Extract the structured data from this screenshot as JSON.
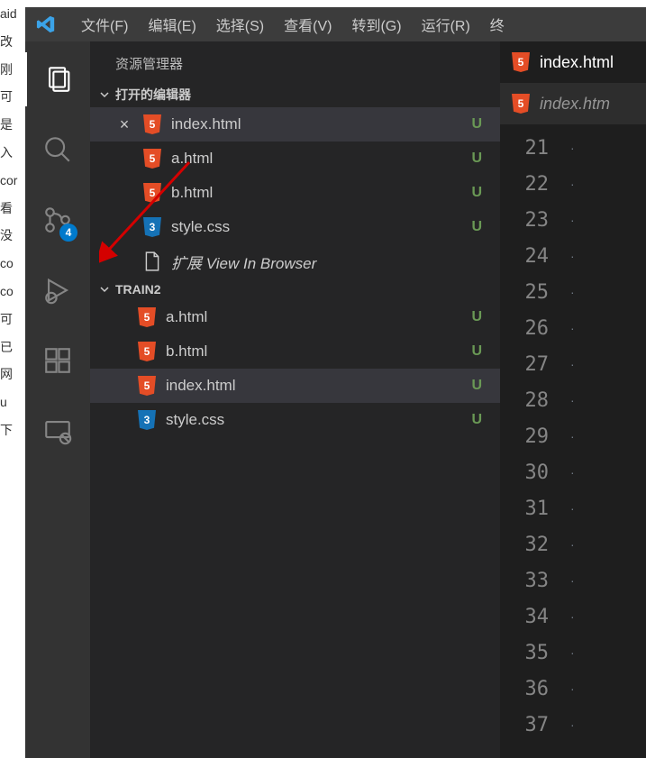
{
  "bg_fragments": [
    "aid",
    "改",
    "刚",
    "可",
    "",
    "是",
    "",
    "入",
    "",
    "",
    "",
    "cor",
    "",
    "",
    "",
    "看",
    "没",
    "co",
    "co",
    "",
    "",
    "可",
    "",
    "",
    "",
    "已",
    "网",
    "u",
    "下"
  ],
  "menubar": [
    "文件(F)",
    "编辑(E)",
    "选择(S)",
    "查看(V)",
    "转到(G)",
    "运行(R)",
    "终"
  ],
  "activity_badge": "4",
  "sidebar": {
    "title": "资源管理器",
    "open_editors_label": "打开的编辑器",
    "open_editors": [
      {
        "name": "index.html",
        "icon": "html5",
        "status": "U",
        "active": true,
        "closable": true
      },
      {
        "name": "a.html",
        "icon": "html5",
        "status": "U"
      },
      {
        "name": "b.html",
        "icon": "html5",
        "status": "U"
      },
      {
        "name": "style.css",
        "icon": "css3",
        "status": "U"
      },
      {
        "name": "扩展 View In Browser",
        "icon": "file",
        "italic": true
      }
    ],
    "project_label": "TRAIN2",
    "project_files": [
      {
        "name": "a.html",
        "icon": "html5",
        "status": "U"
      },
      {
        "name": "b.html",
        "icon": "html5",
        "status": "U"
      },
      {
        "name": "index.html",
        "icon": "html5",
        "status": "U",
        "active": true
      },
      {
        "name": "style.css",
        "icon": "css3",
        "status": "U"
      }
    ]
  },
  "tabs": [
    {
      "name": "index.html",
      "icon": "html5",
      "active": true
    },
    {
      "name": "index.htm",
      "icon": "html5",
      "active": false
    }
  ],
  "line_start": 21,
  "line_end": 37
}
